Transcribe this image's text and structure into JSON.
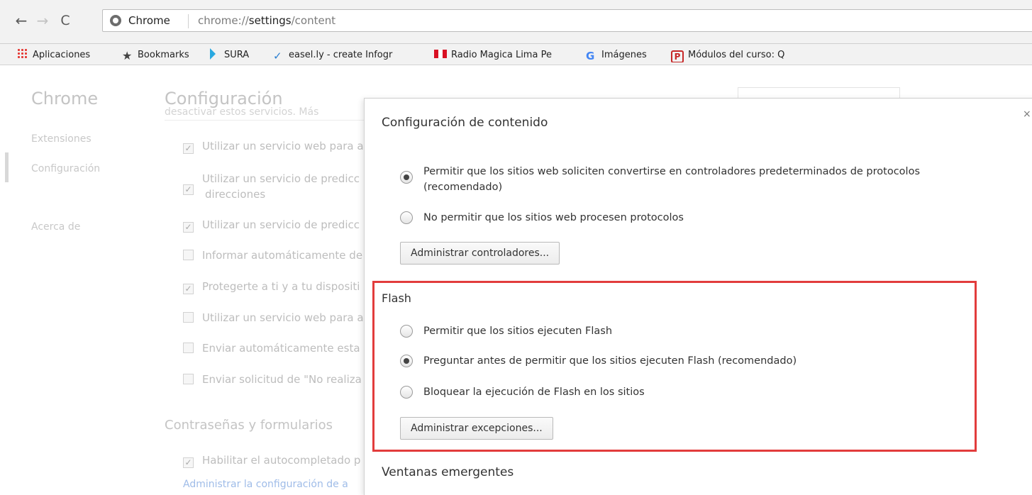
{
  "toolbar": {
    "origin_label": "Chrome",
    "url_prefix": "chrome://",
    "url_host": "settings",
    "url_path": "/content"
  },
  "bookmarks": [
    {
      "label": "Aplicaciones",
      "icon": "apps-grid-icon"
    },
    {
      "label": "Bookmarks",
      "icon": "star-icon"
    },
    {
      "label": "SURA",
      "icon": "sura-icon"
    },
    {
      "label": "easel.ly - create Infogr",
      "icon": "easelly-icon"
    },
    {
      "label": "Radio Magica Lima Pe",
      "icon": "peru-flag-icon"
    },
    {
      "label": "Imágenes",
      "icon": "google-icon"
    },
    {
      "label": "Módulos del curso: Q",
      "icon": "pluralsight-icon"
    }
  ],
  "sidebar": {
    "title": "Chrome",
    "items": [
      "Extensiones",
      "Configuración",
      "Acerca de"
    ]
  },
  "settings": {
    "title": "Configuración",
    "cut_line": "desactivar estos servicios. Más",
    "checkbox_rows": [
      {
        "label": "Utilizar un servicio web para a",
        "checked": true
      },
      {
        "label": "Utilizar un servicio de predicc",
        "checked": true
      },
      {
        "label": "direcciones",
        "checked": null
      },
      {
        "label": "Utilizar un servicio de predicc",
        "checked": true
      },
      {
        "label": "Informar automáticamente de",
        "checked": false
      },
      {
        "label": "Protegerte a ti y a tu dispositi",
        "checked": true
      },
      {
        "label": "Utilizar un servicio web para a",
        "checked": false
      },
      {
        "label": "Enviar automáticamente esta",
        "checked": false
      },
      {
        "label": "Enviar solicitud de \"No realiza",
        "checked": false
      }
    ],
    "passwords_section": "Contraseñas y formularios",
    "autofill_row": "Habilitar el autocompletado p",
    "manage_link": "Administrar la configuración de a"
  },
  "dialog": {
    "title": "Configuración de contenido",
    "handlers": {
      "allow_label_line1": "Permitir que los sitios web soliciten convertirse en controladores predeterminados de protocolos",
      "allow_label_line2": "(recomendado)",
      "deny_label": "No permitir que los sitios web procesen protocolos",
      "manage_button": "Administrar controladores...",
      "selected": "allow"
    },
    "flash": {
      "heading": "Flash",
      "options": [
        "Permitir que los sitios ejecuten Flash",
        "Preguntar antes de permitir que los sitios ejecuten Flash (recomendado)",
        "Bloquear la ejecución de Flash en los sitios"
      ],
      "selected_index": 1,
      "manage_button": "Administrar excepciones..."
    },
    "popups_heading": "Ventanas emergentes"
  },
  "colors": {
    "highlight": "#e23c3c",
    "link": "#9fbce8"
  }
}
